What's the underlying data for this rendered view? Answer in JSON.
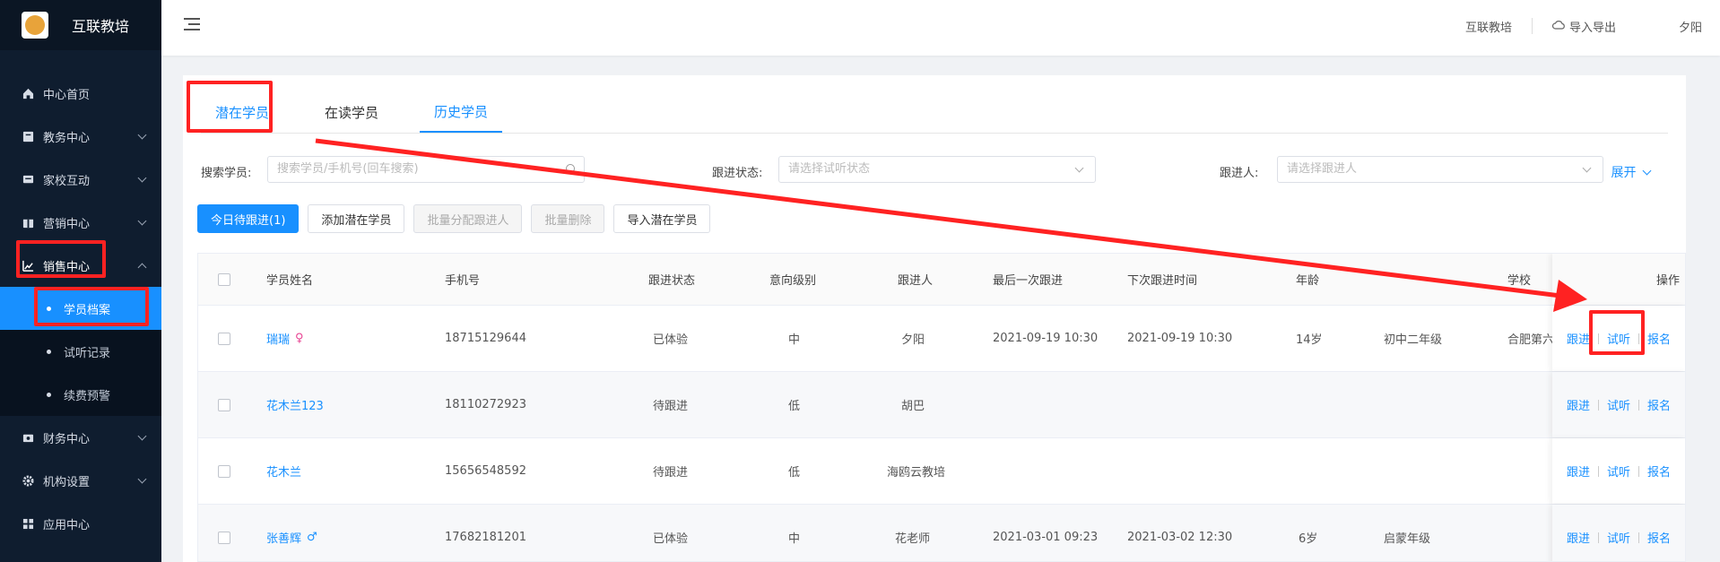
{
  "brand": {
    "name": "互联教培"
  },
  "menu": {
    "home": "中心首页",
    "edu": "教务中心",
    "homeschool": "家校互动",
    "marketing": "营销中心",
    "sales": "销售中心",
    "sub": [
      "学员档案",
      "试听记录",
      "续费预警"
    ],
    "finance": "财务中心",
    "org": "机构设置",
    "apps": "应用中心"
  },
  "header": {
    "org": "互联教培",
    "import_export": "导入导出",
    "user": "夕阳"
  },
  "tabs": [
    "潜在学员",
    "在读学员",
    "历史学员"
  ],
  "filters": {
    "search_label": "搜索学员:",
    "search_placeholder": "搜索学员/手机号(回车搜索)",
    "status_label": "跟进状态:",
    "status_placeholder": "请选择试听状态",
    "follower_label": "跟进人:",
    "follower_placeholder": "请选择跟进人",
    "expand": "展开"
  },
  "buttons": {
    "today": "今日待跟进(1)",
    "add": "添加潜在学员",
    "batch_assign": "批量分配跟进人",
    "batch_delete": "批量删除",
    "import": "导入潜在学员"
  },
  "table": {
    "columns": [
      "学员姓名",
      "手机号",
      "跟进状态",
      "意向级别",
      "跟进人",
      "最后一次跟进",
      "下次跟进时间",
      "年龄",
      "学校",
      "操作"
    ],
    "rows": [
      {
        "name": "瑞瑞",
        "gender": "♀",
        "phone": "18715129644",
        "status": "已体验",
        "level": "中",
        "follower": "夕阳",
        "last": "2021-09-19 10:30",
        "next": "2021-09-19 10:30",
        "age": "14岁",
        "grade": "初中二年级",
        "school": "合肥第六"
      },
      {
        "name": "花木兰123",
        "gender": "",
        "phone": "18110272923",
        "status": "待跟进",
        "level": "低",
        "follower": "胡巴",
        "last": "",
        "next": "",
        "age": "",
        "grade": "",
        "school": ""
      },
      {
        "name": "花木兰",
        "gender": "",
        "phone": "15656548592",
        "status": "待跟进",
        "level": "低",
        "follower": "海鸥云教培",
        "last": "",
        "next": "",
        "age": "",
        "grade": "",
        "school": ""
      },
      {
        "name": "张善辉",
        "gender": "♂",
        "phone": "17682181201",
        "status": "已体验",
        "level": "中",
        "follower": "花老师",
        "last": "2021-03-01 09:23",
        "next": "2021-03-02 12:30",
        "age": "6岁",
        "grade": "启蒙年级",
        "school": ""
      }
    ],
    "ops": [
      "跟进",
      "试听",
      "报名"
    ]
  },
  "colors": {
    "accent": "#1890ff",
    "sidebar": "#0f1d2f",
    "annotation": "#ff2222"
  }
}
